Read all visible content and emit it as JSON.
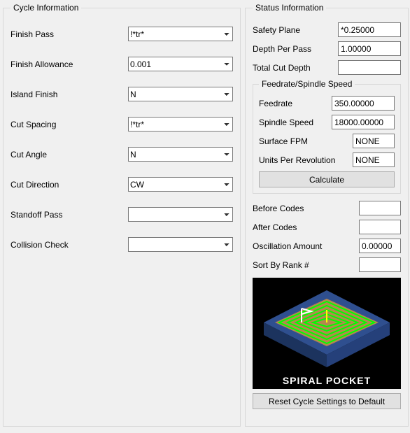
{
  "cycle_info": {
    "legend": "Cycle Information",
    "rows": {
      "finish_pass": {
        "label": "Finish Pass",
        "value": "!*tr*"
      },
      "finish_allowance": {
        "label": "Finish Allowance",
        "value": "0.001"
      },
      "island_finish": {
        "label": "Island Finish",
        "value": "N"
      },
      "cut_spacing": {
        "label": "Cut Spacing",
        "value": "!*tr*"
      },
      "cut_angle": {
        "label": "Cut Angle",
        "value": "N"
      },
      "cut_direction": {
        "label": "Cut Direction",
        "value": "CW"
      },
      "standoff_pass": {
        "label": "Standoff Pass",
        "value": ""
      },
      "collision_check": {
        "label": "Collision Check",
        "value": ""
      }
    }
  },
  "status_info": {
    "legend": "Status Information",
    "safety_plane": {
      "label": "Safety Plane",
      "value": "*0.25000"
    },
    "depth_per_pass": {
      "label": "Depth Per Pass",
      "value": "1.00000"
    },
    "total_cut_depth": {
      "label": "Total Cut Depth",
      "value": ""
    },
    "feedrate_group": {
      "legend": "Feedrate/Spindle Speed",
      "feedrate": {
        "label": "Feedrate",
        "value": "350.00000"
      },
      "spindle_speed": {
        "label": "Spindle Speed",
        "value": "18000.00000"
      },
      "surface_fpm": {
        "label": "Surface FPM",
        "value": "NONE"
      },
      "units_per_rev": {
        "label": "Units Per Revolution",
        "value": "NONE"
      },
      "calculate_btn": "Calculate"
    },
    "before_codes": {
      "label": "Before Codes",
      "value": ""
    },
    "after_codes": {
      "label": "After Codes",
      "value": ""
    },
    "osc_amount": {
      "label": "Oscillation Amount",
      "value": "0.00000"
    },
    "sort_by_rank": {
      "label": "Sort By Rank #",
      "value": ""
    },
    "illustration_caption": "SPIRAL POCKET",
    "reset_btn": "Reset Cycle Settings to Default"
  }
}
